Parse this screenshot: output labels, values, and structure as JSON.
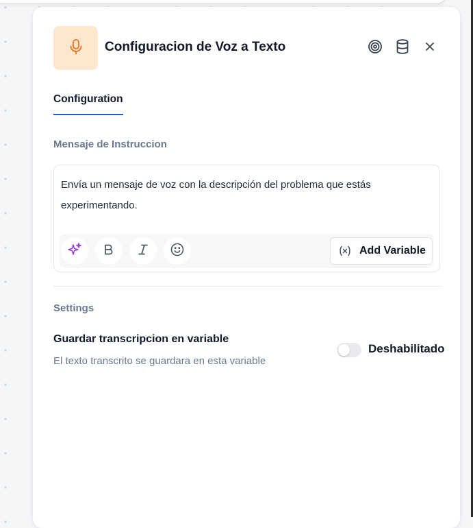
{
  "panel": {
    "title": "Configuracion de Voz a Texto",
    "header_icons": [
      "microphone-icon",
      "target-icon",
      "database-icon",
      "close-icon"
    ],
    "accent_colors": {
      "icon_bg": "#fde7cf",
      "icon": "#f07a2a",
      "tab_underline": "#1e5bd6",
      "ai": "#9b3fd4"
    }
  },
  "tabs": [
    {
      "label": "Configuration",
      "active": true
    }
  ],
  "message": {
    "label": "Mensaje de Instruccion",
    "text_line1": "Envía un mensaje de voz con la descripción del problema que estás",
    "text_line2": "experimentando.",
    "toolbar": {
      "icons": [
        "sparkle-icon",
        "bold-icon",
        "italic-icon",
        "emoji-icon"
      ],
      "add_variable_label": "Add Variable"
    }
  },
  "settings": {
    "label": "Settings",
    "save_transcription": {
      "title": "Guardar transcripcion en variable",
      "description": "El texto transcrito se guardara en esta variable",
      "toggle_on": false,
      "toggle_label": "Deshabilitado"
    }
  }
}
